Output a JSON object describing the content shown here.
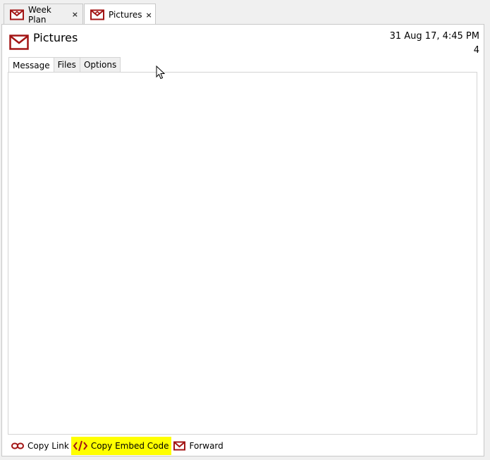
{
  "tabs": [
    {
      "label": "Week Plan",
      "close": "×",
      "icon": "envelope-icon"
    },
    {
      "label": "Pictures",
      "close": "×",
      "icon": "envelope-icon"
    }
  ],
  "message": {
    "title": "Pictures",
    "date": "31 Aug 17, 4:45 PM",
    "count": "4",
    "icon": "envelope-icon"
  },
  "inner_tabs": [
    "Message",
    "Files",
    "Options"
  ],
  "toolbar": {
    "copy_link": "Copy Link",
    "copy_embed": "Copy Embed Code",
    "forward": "Forward"
  },
  "colors": {
    "accent": "#a31515",
    "highlight": "#ffff00"
  }
}
